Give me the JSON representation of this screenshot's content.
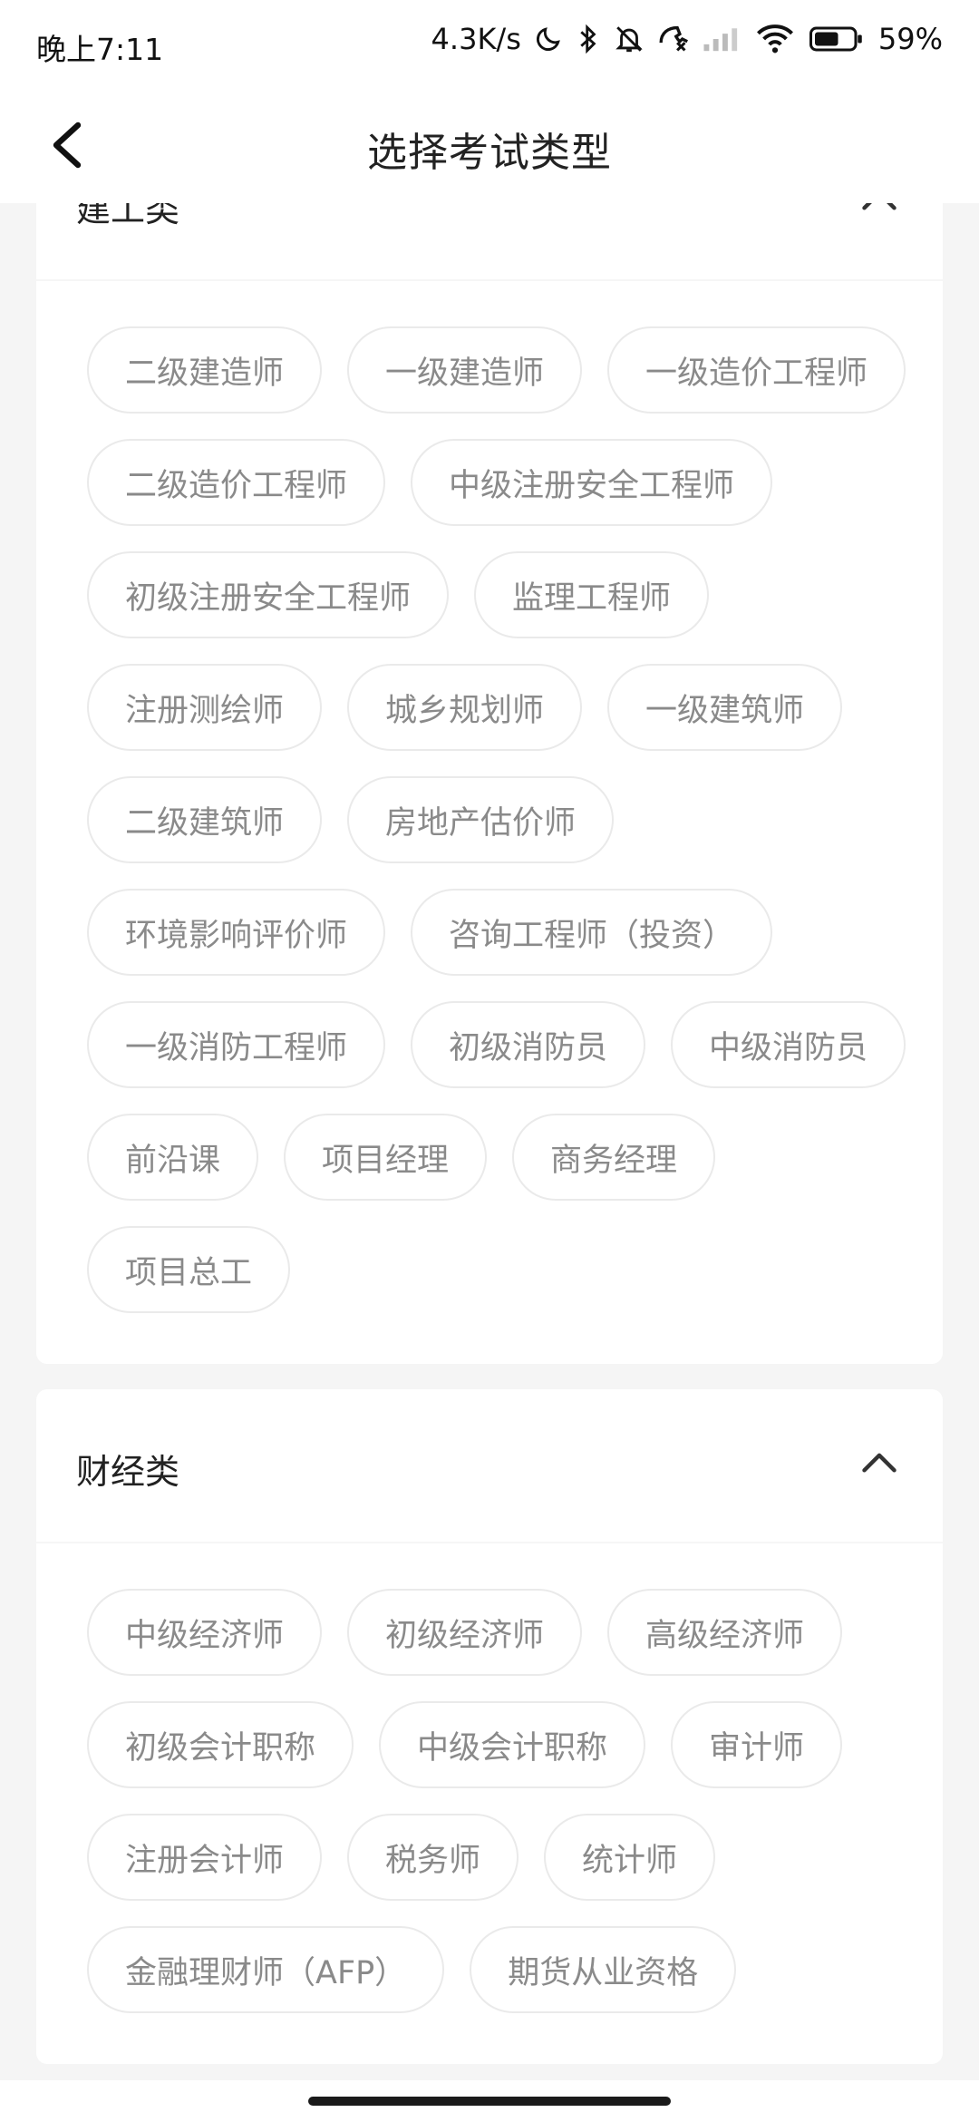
{
  "status_bar": {
    "time": "晚上7:11",
    "speed": "4.3K/s",
    "battery": "59%",
    "icons": [
      "moon-icon",
      "bluetooth-icon",
      "bell-off-icon",
      "phone-icon",
      "signal-icon",
      "wifi-icon",
      "battery-icon"
    ]
  },
  "nav": {
    "title": "选择考试类型",
    "back_icon": "chevron-left-icon"
  },
  "sections": [
    {
      "title": "建工类",
      "expanded": true,
      "tags": [
        "二级建造师",
        "一级建造师",
        "一级造价工程师",
        "二级造价工程师",
        "中级注册安全工程师",
        "初级注册安全工程师",
        "监理工程师",
        "注册测绘师",
        "城乡规划师",
        "一级建筑师",
        "二级建筑师",
        "房地产估价师",
        "环境影响评价师",
        "咨询工程师（投资）",
        "一级消防工程师",
        "初级消防员",
        "中级消防员",
        "前沿课",
        "项目经理",
        "商务经理",
        "项目总工"
      ]
    },
    {
      "title": "财经类",
      "expanded": true,
      "tags": [
        "中级经济师",
        "初级经济师",
        "高级经济师",
        "初级会计职称",
        "中级会计职称",
        "审计师",
        "注册会计师",
        "税务师",
        "统计师",
        "金融理财师（AFP）",
        "期货从业资格"
      ]
    }
  ],
  "colors": {
    "background": "#f5f5f5",
    "card": "#ffffff",
    "tag_text": "#8a8a8a",
    "tag_border": "#eaeaea"
  }
}
